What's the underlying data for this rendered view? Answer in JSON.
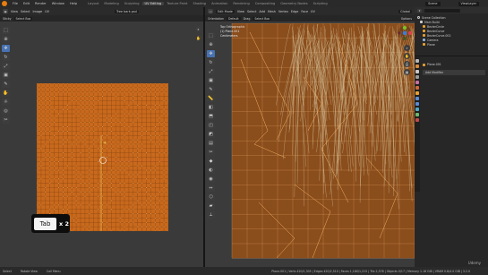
{
  "topbar": {
    "menus": [
      "File",
      "Edit",
      "Render",
      "Window",
      "Help"
    ],
    "workspaces": [
      "Layout",
      "Modeling",
      "Sculpting",
      "UV Editing",
      "Texture Paint",
      "Shading",
      "Animation",
      "Rendering",
      "Compositing",
      "Geometry Nodes",
      "Scripting"
    ],
    "active_workspace": "UV Editing",
    "scene": "Scene",
    "view_layer": "ViewLayer"
  },
  "uv_editor": {
    "header_items": [
      "View",
      "Select",
      "Image",
      "UV"
    ],
    "image_field": "Tree bark.psd",
    "sync_label": "Sticky",
    "select_mode": "Select Box",
    "tools": [
      "select-box",
      "cursor",
      "move",
      "rotate",
      "scale",
      "transform",
      "annotate",
      "grab",
      "relax",
      "pinch",
      "rip"
    ]
  },
  "viewport": {
    "mode": "Edit Mode",
    "header_items": [
      "View",
      "Select",
      "Add",
      "Mesh",
      "Vertex",
      "Edge",
      "Face",
      "UV"
    ],
    "orientation_label": "Orientation",
    "orientation_value": "Default",
    "drag_label": "Drag",
    "drag_value": "Select Box",
    "global_label": "Global",
    "options_label": "Options",
    "info_lines": [
      "Top Orthographic",
      "(1) Plane.001",
      "Centimeters"
    ],
    "gizmo_axes": [
      "X",
      "Y",
      "Z"
    ]
  },
  "outliner": {
    "header": "Scene Collection",
    "items": [
      {
        "name": "Scene Collection"
      },
      {
        "name": "Main Build"
      },
      {
        "name": "BezierCircle"
      },
      {
        "name": "BezierCurve"
      },
      {
        "name": "BezierCurve.002"
      },
      {
        "name": "Camera"
      },
      {
        "name": "Plane"
      }
    ]
  },
  "properties": {
    "object_name": "Plane.001",
    "add_modifier": "Add Modifier"
  },
  "overlay": {
    "key_label": "Tab",
    "count_label": "x 2"
  },
  "statusbar": {
    "items": [
      "Select",
      "Rotate View",
      "Call Menu"
    ],
    "stats": "Plane.001 | Verts 420/1,305 | Edges 420/2,510 | Faces 1,180/1,215 | Tris 2,578 | Objects 0/17 | Memory 1.16 GiB | VRAM 0.8/4.0 GiB | 3.2.0"
  },
  "watermark": "Udemy",
  "colors": {
    "uv_island": "#c8691d",
    "uv_selected": "#f0a14a",
    "accent": "#4772b3",
    "viewport_mesh": "#c86d1e"
  }
}
